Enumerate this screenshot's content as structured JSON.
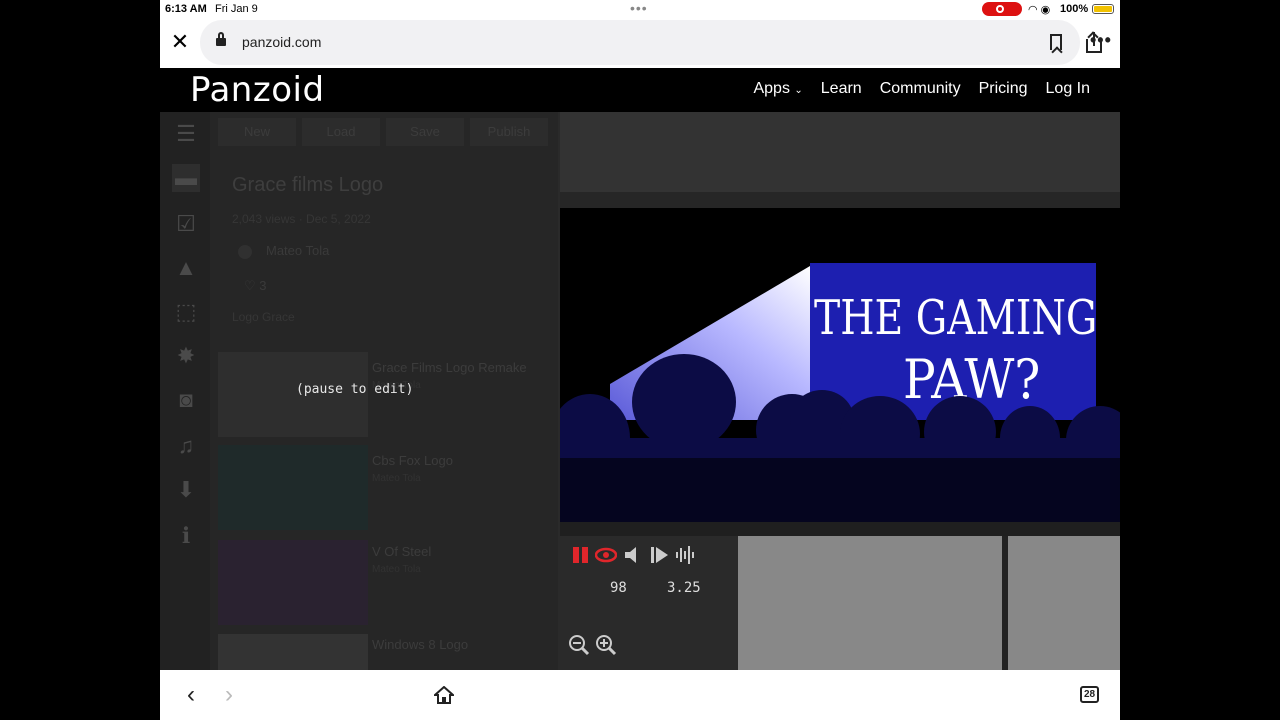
{
  "status_bar": {
    "time": "6:13 AM",
    "date": "Fri Jan 9",
    "battery_pct": "100%"
  },
  "browser": {
    "url": "panzoid.com",
    "tabs_count": "28"
  },
  "site": {
    "logo": "Panzoid",
    "nav": {
      "apps": "Apps",
      "learn": "Learn",
      "community": "Community",
      "pricing": "Pricing",
      "login": "Log In"
    }
  },
  "editor": {
    "top_buttons": [
      "New",
      "Load",
      "Save",
      "Publish"
    ],
    "project": {
      "title": "Grace films Logo",
      "meta": "2,043 views · Dec 5, 2022",
      "author": "Mateo Tola",
      "likes": "3",
      "tags": "Logo Grace"
    },
    "related": [
      {
        "title": "Grace Films Logo Remake",
        "sub": "Mateo Tola"
      },
      {
        "title": "Cbs Fox Logo",
        "sub": "Mateo Tola"
      },
      {
        "title": "V Of Steel",
        "sub": "Mateo Tola"
      },
      {
        "title": "Windows 8 Logo",
        "sub": ""
      }
    ],
    "pause_label": "(pause to edit)",
    "preview_text": {
      "line1": "THE GAMING",
      "line2": "PAW?"
    },
    "frame_value": "98",
    "time_value": "3.25"
  },
  "colors": {
    "accent_red": "#e0262b",
    "screen_blue": "#1d1fb0"
  }
}
